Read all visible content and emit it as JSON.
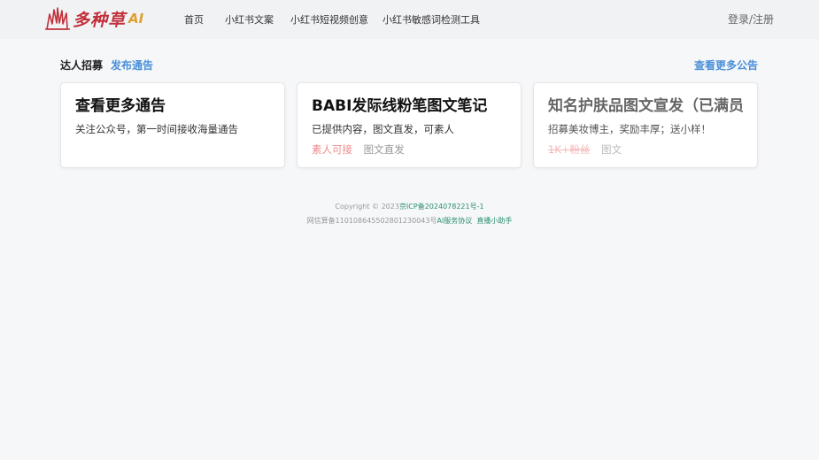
{
  "brand": {
    "name": "多种草",
    "ai": "AI",
    "colors": {
      "primary": "#c2303a",
      "accent": "#e0a030"
    }
  },
  "nav": {
    "items": [
      "首页",
      "小红书文案",
      "小红书短视频创意",
      "小红书敏感词检测工具"
    ]
  },
  "header": {
    "login_label": "登录/注册"
  },
  "section": {
    "title": "达人招募",
    "publish_label": "发布通告",
    "more_label": "查看更多公告"
  },
  "cards": [
    {
      "title": "查看更多通告",
      "desc": "关注公众号，第一时间接收海量通告",
      "tags": []
    },
    {
      "title": "BABI发际线粉笔图文笔记",
      "desc": "已提供内容，图文直发，可素人",
      "tags": [
        "素人可接",
        "图文直发"
      ]
    },
    {
      "title": "知名护肤品图文宣发（已满员）",
      "desc": "招募美妆博主，奖励丰厚；送小样！",
      "tags": [
        "1K+粉丝",
        "图文"
      ]
    }
  ],
  "footer": {
    "copyright_prefix": "Copyright © 2023",
    "icp": "京ICP备2024078221号-1",
    "algo_record": "网信算备110108645502801230043号",
    "ai_agreement": "AI服务协议",
    "helper": "直播小助手"
  }
}
